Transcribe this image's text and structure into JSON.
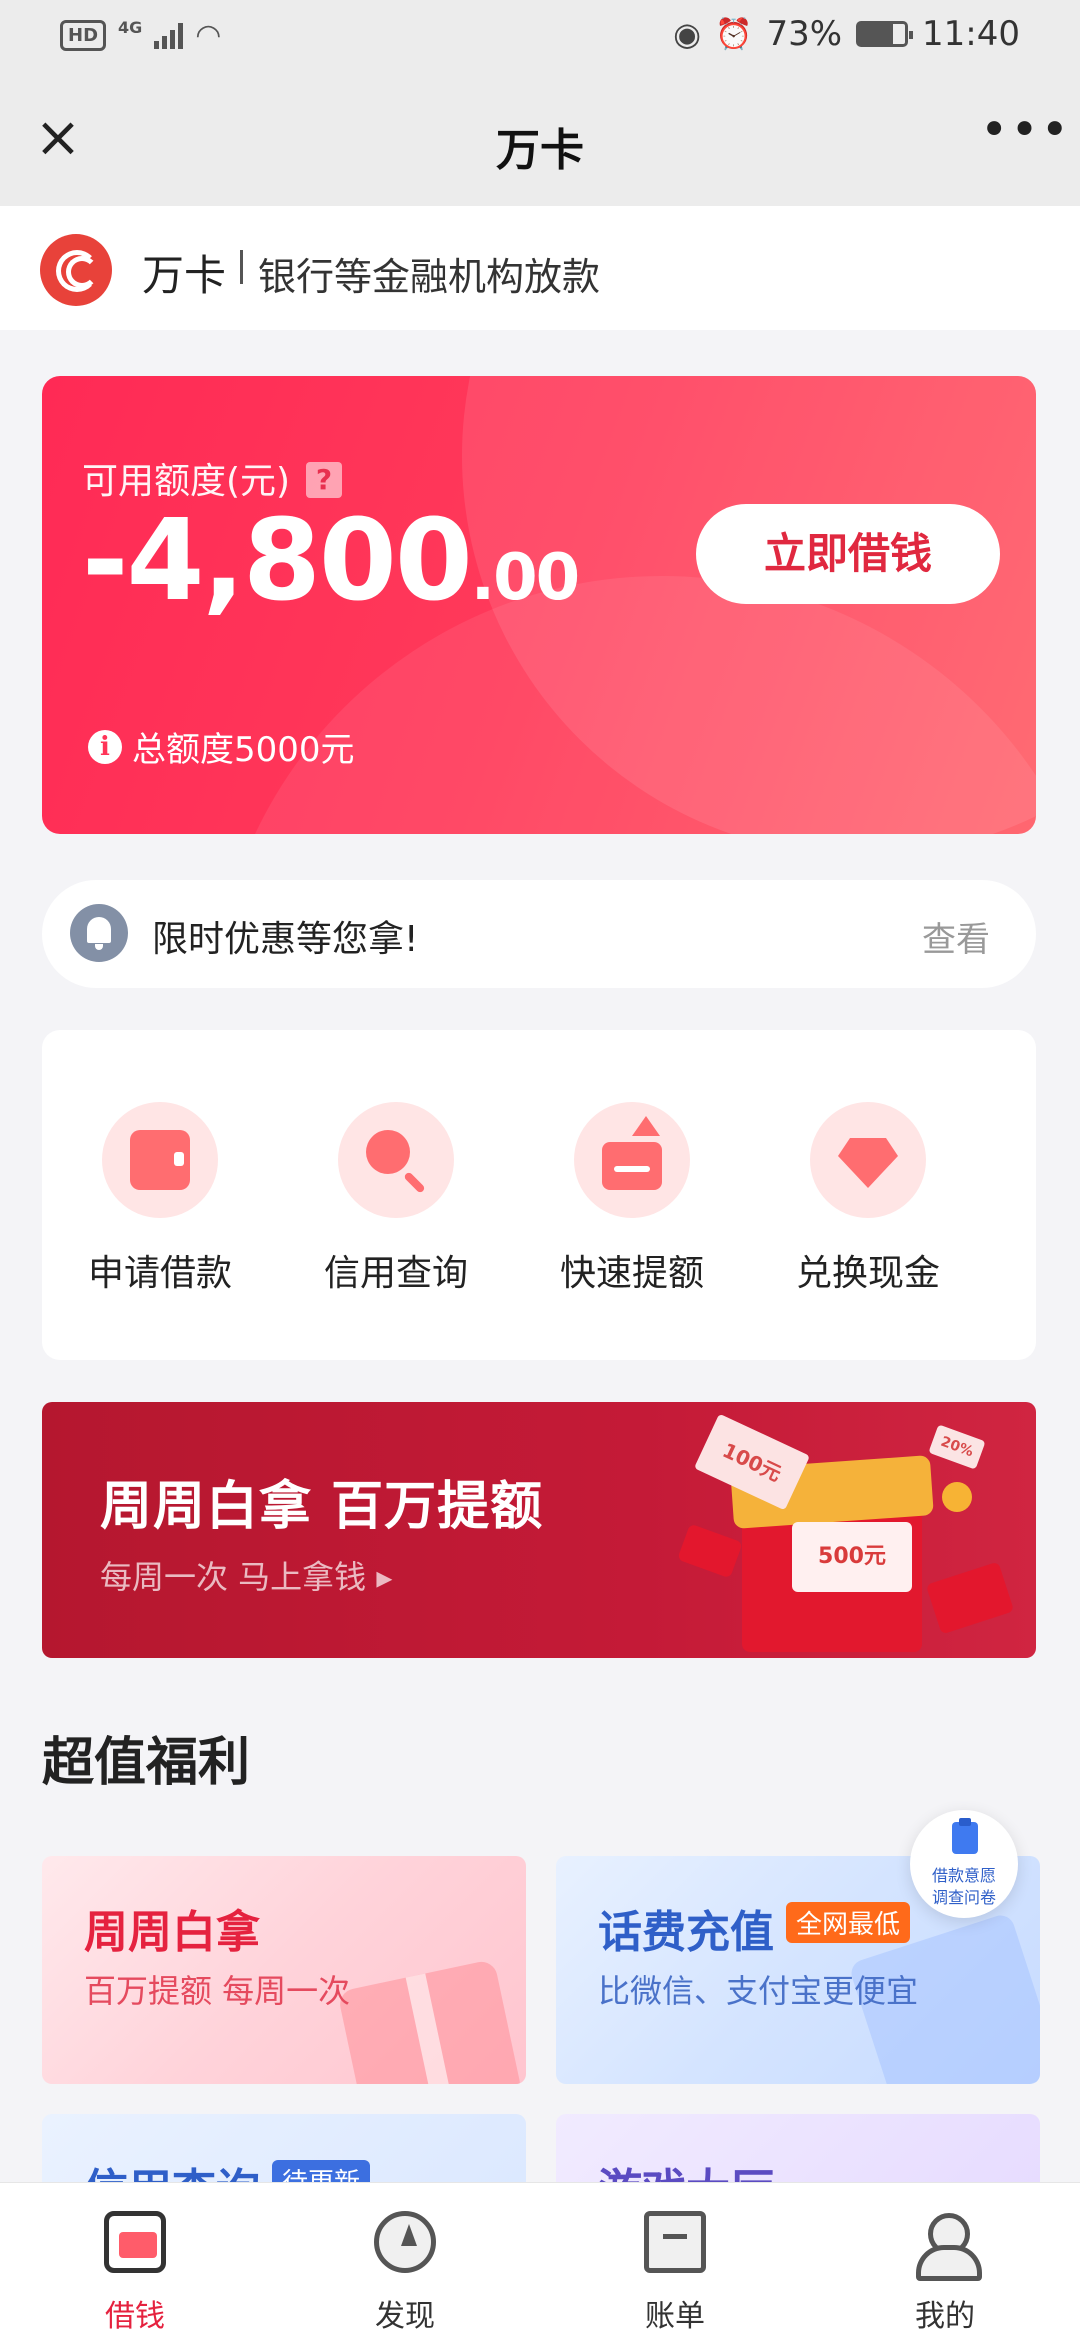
{
  "status_bar": {
    "hd": "HD",
    "network": "4G",
    "battery": "73%",
    "battery_level": 0.73,
    "time": "11:40"
  },
  "title_bar": {
    "title": "万卡",
    "close_icon": "close-icon",
    "more_icon": "more-icon"
  },
  "brand": {
    "name": "万卡",
    "description": "银行等金融机构放款"
  },
  "credit_card": {
    "label": "可用额度(元)",
    "help": "?",
    "amount_integer": "-4,800",
    "amount_decimal": ".00",
    "button": "立即借钱",
    "info": "i",
    "total": "总额度5000元"
  },
  "notice": {
    "text": "限时优惠等您拿!",
    "link": "查看"
  },
  "actions": [
    {
      "label": "申请借款",
      "icon": "wallet-icon"
    },
    {
      "label": "信用查询",
      "icon": "search-icon"
    },
    {
      "label": "快速提额",
      "icon": "upload-icon"
    },
    {
      "label": "兑换现金",
      "icon": "diamond-icon"
    }
  ],
  "promo": {
    "title": "周周白拿 百万提额",
    "subtitle": "每周一次  马上拿钱 ▸",
    "note_100": "100元",
    "note_500": "500元",
    "tag_20": "20%"
  },
  "section": {
    "title": "超值福利"
  },
  "benefits": [
    {
      "title": "周周白拿",
      "desc": "百万提额 每周一次",
      "tag": ""
    },
    {
      "title": "话费充值",
      "desc": "比微信、支付宝更便宜",
      "tag": "全网最低"
    },
    {
      "title": "信用查询",
      "desc": "",
      "tag": "待更新"
    },
    {
      "title": "游戏大厅",
      "desc": "",
      "tag": ""
    }
  ],
  "float_survey": {
    "line1": "借款意愿",
    "line2": "调查问卷"
  },
  "bottom_nav": [
    {
      "label": "借钱",
      "icon": "wallet-icon",
      "active": true
    },
    {
      "label": "发现",
      "icon": "compass-icon",
      "active": false
    },
    {
      "label": "账单",
      "icon": "bill-icon",
      "active": false
    },
    {
      "label": "我的",
      "icon": "user-icon",
      "active": false
    }
  ],
  "colors": {
    "accent": "#e5223f",
    "card_gradient_start": "#ff2a55",
    "promo_bg": "#b5172f"
  }
}
